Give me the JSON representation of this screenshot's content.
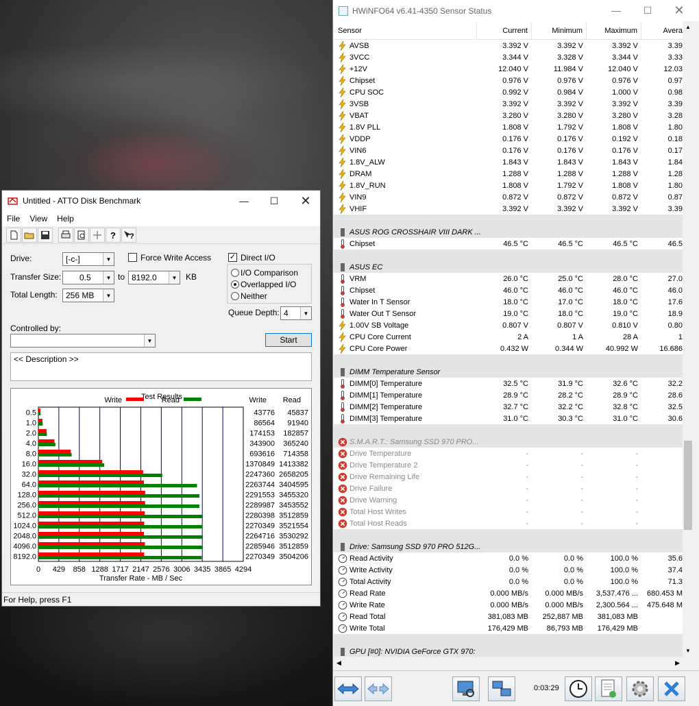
{
  "atto": {
    "title": "Untitled - ATTO Disk Benchmark",
    "menu": [
      "File",
      "View",
      "Help"
    ],
    "drive_label": "Drive:",
    "drive_value": "[-c-]",
    "transfer_label": "Transfer Size:",
    "transfer_from": "0.5",
    "to_label": "to",
    "transfer_to": "8192.0",
    "kb_label": "KB",
    "total_length_label": "Total Length:",
    "total_length": "256 MB",
    "force_write": "Force Write Access",
    "direct_io": "Direct I/O",
    "io_comparison": "I/O Comparison",
    "overlapped_io": "Overlapped I/O",
    "neither": "Neither",
    "queue_depth_label": "Queue Depth:",
    "queue_depth": "4",
    "controlled_by": "Controlled by:",
    "start": "Start",
    "description": "<< Description >>",
    "status": "For Help, press F1"
  },
  "chart_data": {
    "type": "bar",
    "title": "Test Results",
    "xlabel": "Transfer Rate - MB / Sec",
    "xticks": [
      "0",
      "429",
      "858",
      "1288",
      "1717",
      "2147",
      "2576",
      "3006",
      "3435",
      "3865",
      "4294"
    ],
    "xlim": [
      0,
      4294
    ],
    "categories": [
      "0.5",
      "1.0",
      "2.0",
      "4.0",
      "8.0",
      "16.0",
      "32.0",
      "64.0",
      "128.0",
      "256.0",
      "512.0",
      "1024.0",
      "2048.0",
      "4096.0",
      "8192.0"
    ],
    "series": [
      {
        "name": "Write",
        "color": "#ff0000",
        "values_kb": [
          43776,
          86564,
          174153,
          343900,
          693616,
          1370849,
          2247360,
          2263744,
          2291553,
          2289987,
          2280398,
          2270349,
          2264716,
          2285946,
          2270349
        ]
      },
      {
        "name": "Read",
        "color": "#008000",
        "values_kb": [
          45837,
          91940,
          182857,
          365240,
          714358,
          1413382,
          2658205,
          3404595,
          3455320,
          3453552,
          3512859,
          3521554,
          3530292,
          3512859,
          3504206
        ]
      }
    ],
    "col_write": "Write",
    "col_read": "Read",
    "legend": "top"
  },
  "hwinfo": {
    "title": "HWiNFO64 v6.41-4350 Sensor Status",
    "columns": [
      "Sensor",
      "Current",
      "Minimum",
      "Maximum",
      "Avera"
    ],
    "timer": "0:03:29",
    "rows": [
      {
        "icon": "bolt",
        "name": "AVSB",
        "cur": "3.392 V",
        "min": "3.392 V",
        "max": "3.392 V",
        "avg": "3.39"
      },
      {
        "icon": "bolt",
        "name": "3VCC",
        "cur": "3.344 V",
        "min": "3.328 V",
        "max": "3.344 V",
        "avg": "3.33"
      },
      {
        "icon": "bolt",
        "name": "+12V",
        "cur": "12.040 V",
        "min": "11.984 V",
        "max": "12.040 V",
        "avg": "12.03"
      },
      {
        "icon": "bolt",
        "name": "Chipset",
        "cur": "0.976 V",
        "min": "0.976 V",
        "max": "0.976 V",
        "avg": "0.97"
      },
      {
        "icon": "bolt",
        "name": "CPU SOC",
        "cur": "0.992 V",
        "min": "0.984 V",
        "max": "1.000 V",
        "avg": "0.98"
      },
      {
        "icon": "bolt",
        "name": "3VSB",
        "cur": "3.392 V",
        "min": "3.392 V",
        "max": "3.392 V",
        "avg": "3.39"
      },
      {
        "icon": "bolt",
        "name": "VBAT",
        "cur": "3.280 V",
        "min": "3.280 V",
        "max": "3.280 V",
        "avg": "3.28"
      },
      {
        "icon": "bolt",
        "name": "1.8V PLL",
        "cur": "1.808 V",
        "min": "1.792 V",
        "max": "1.808 V",
        "avg": "1.80"
      },
      {
        "icon": "bolt",
        "name": "VDDP",
        "cur": "0.176 V",
        "min": "0.176 V",
        "max": "0.192 V",
        "avg": "0.18"
      },
      {
        "icon": "bolt",
        "name": "VIN6",
        "cur": "0.176 V",
        "min": "0.176 V",
        "max": "0.176 V",
        "avg": "0.17"
      },
      {
        "icon": "bolt",
        "name": "1.8V_ALW",
        "cur": "1.843 V",
        "min": "1.843 V",
        "max": "1.843 V",
        "avg": "1.84"
      },
      {
        "icon": "bolt",
        "name": "DRAM",
        "cur": "1.288 V",
        "min": "1.288 V",
        "max": "1.288 V",
        "avg": "1.28"
      },
      {
        "icon": "bolt",
        "name": "1.8V_RUN",
        "cur": "1.808 V",
        "min": "1.792 V",
        "max": "1.808 V",
        "avg": "1.80"
      },
      {
        "icon": "bolt",
        "name": "VIN9",
        "cur": "0.872 V",
        "min": "0.872 V",
        "max": "0.872 V",
        "avg": "0.87"
      },
      {
        "icon": "bolt",
        "name": "VHIF",
        "cur": "3.392 V",
        "min": "3.392 V",
        "max": "3.392 V",
        "avg": "3.39"
      },
      {
        "type": "spacer"
      },
      {
        "type": "section",
        "icon": "chip",
        "name": "ASUS ROG CROSSHAIR VIII DARK ..."
      },
      {
        "icon": "therm",
        "name": "Chipset",
        "cur": "46.5 °C",
        "min": "46.5 °C",
        "max": "46.5 °C",
        "avg": "46.5"
      },
      {
        "type": "spacer"
      },
      {
        "type": "section",
        "icon": "chip",
        "name": "ASUS EC"
      },
      {
        "icon": "therm",
        "name": "VRM",
        "cur": "26.0 °C",
        "min": "25.0 °C",
        "max": "28.0 °C",
        "avg": "27.0"
      },
      {
        "icon": "therm",
        "name": "Chipset",
        "cur": "46.0 °C",
        "min": "46.0 °C",
        "max": "46.0 °C",
        "avg": "46.0"
      },
      {
        "icon": "therm",
        "name": "Water In T Sensor",
        "cur": "18.0 °C",
        "min": "17.0 °C",
        "max": "18.0 °C",
        "avg": "17.6"
      },
      {
        "icon": "therm",
        "name": "Water Out T Sensor",
        "cur": "19.0 °C",
        "min": "18.0 °C",
        "max": "19.0 °C",
        "avg": "18.9"
      },
      {
        "icon": "bolt",
        "name": "1.00V SB Voltage",
        "cur": "0.807 V",
        "min": "0.807 V",
        "max": "0.810 V",
        "avg": "0.80"
      },
      {
        "icon": "bolt",
        "name": "CPU Core Current",
        "cur": "2 A",
        "min": "1 A",
        "max": "28 A",
        "avg": "1"
      },
      {
        "icon": "bolt",
        "name": "CPU Core Power",
        "cur": "0.432 W",
        "min": "0.344 W",
        "max": "40.992 W",
        "avg": "16.686"
      },
      {
        "type": "spacer"
      },
      {
        "type": "section",
        "icon": "chip",
        "name": "DIMM Temperature Sensor"
      },
      {
        "icon": "therm",
        "name": "DIMM[0] Temperature",
        "cur": "32.5 °C",
        "min": "31.9 °C",
        "max": "32.6 °C",
        "avg": "32.2"
      },
      {
        "icon": "therm",
        "name": "DIMM[1] Temperature",
        "cur": "28.9 °C",
        "min": "28.2 °C",
        "max": "28.9 °C",
        "avg": "28.6"
      },
      {
        "icon": "therm",
        "name": "DIMM[2] Temperature",
        "cur": "32.7 °C",
        "min": "32.2 °C",
        "max": "32.8 °C",
        "avg": "32.5"
      },
      {
        "icon": "therm",
        "name": "DIMM[3] Temperature",
        "cur": "31.0 °C",
        "min": "30.3 °C",
        "max": "31.0 °C",
        "avg": "30.6"
      },
      {
        "type": "spacer"
      },
      {
        "type": "section",
        "icon": "err",
        "dim": true,
        "name": "S.M.A.R.T.: Samsung SSD 970 PRO..."
      },
      {
        "icon": "err",
        "dim": true,
        "name": "Drive Temperature",
        "cur": "-",
        "min": "-",
        "max": "-",
        "avg": ""
      },
      {
        "icon": "err",
        "dim": true,
        "name": "Drive Temperature 2",
        "cur": "-",
        "min": "-",
        "max": "-",
        "avg": ""
      },
      {
        "icon": "err",
        "dim": true,
        "name": "Drive Remaining Life",
        "cur": "-",
        "min": "-",
        "max": "-",
        "avg": ""
      },
      {
        "icon": "err",
        "dim": true,
        "name": "Drive Failure",
        "cur": "-",
        "min": "-",
        "max": "-",
        "avg": ""
      },
      {
        "icon": "err",
        "dim": true,
        "name": "Drive Warning",
        "cur": "-",
        "min": "-",
        "max": "-",
        "avg": ""
      },
      {
        "icon": "err",
        "dim": true,
        "name": "Total Host Writes",
        "cur": "-",
        "min": "-",
        "max": "-",
        "avg": ""
      },
      {
        "icon": "err",
        "dim": true,
        "name": "Total Host Reads",
        "cur": "-",
        "min": "-",
        "max": "-",
        "avg": ""
      },
      {
        "type": "spacer"
      },
      {
        "type": "section",
        "icon": "chip",
        "name": "Drive: Samsung SSD 970 PRO 512G..."
      },
      {
        "icon": "dial",
        "name": "Read Activity",
        "cur": "0.0 %",
        "min": "0.0 %",
        "max": "100.0 %",
        "avg": "35.6"
      },
      {
        "icon": "dial",
        "name": "Write Activity",
        "cur": "0.0 %",
        "min": "0.0 %",
        "max": "100.0 %",
        "avg": "37.4"
      },
      {
        "icon": "dial",
        "name": "Total Activity",
        "cur": "0.0 %",
        "min": "0.0 %",
        "max": "100.0 %",
        "avg": "71.3"
      },
      {
        "icon": "dial",
        "name": "Read Rate",
        "cur": "0.000 MB/s",
        "min": "0.000 MB/s",
        "max": "3,537.476 ...",
        "avg": "680.453 M"
      },
      {
        "icon": "dial",
        "name": "Write Rate",
        "cur": "0.000 MB/s",
        "min": "0.000 MB/s",
        "max": "2,300.564 ...",
        "avg": "475.648 M"
      },
      {
        "icon": "dial",
        "name": "Read Total",
        "cur": "381,083 MB",
        "min": "252,887 MB",
        "max": "381,083 MB",
        "avg": ""
      },
      {
        "icon": "dial",
        "name": "Write Total",
        "cur": "176,429 MB",
        "min": "86,793 MB",
        "max": "176,429 MB",
        "avg": ""
      },
      {
        "type": "spacer"
      },
      {
        "type": "section",
        "icon": "chip",
        "name": "GPU [#0]: NVIDIA GeForce GTX 970:"
      }
    ]
  }
}
